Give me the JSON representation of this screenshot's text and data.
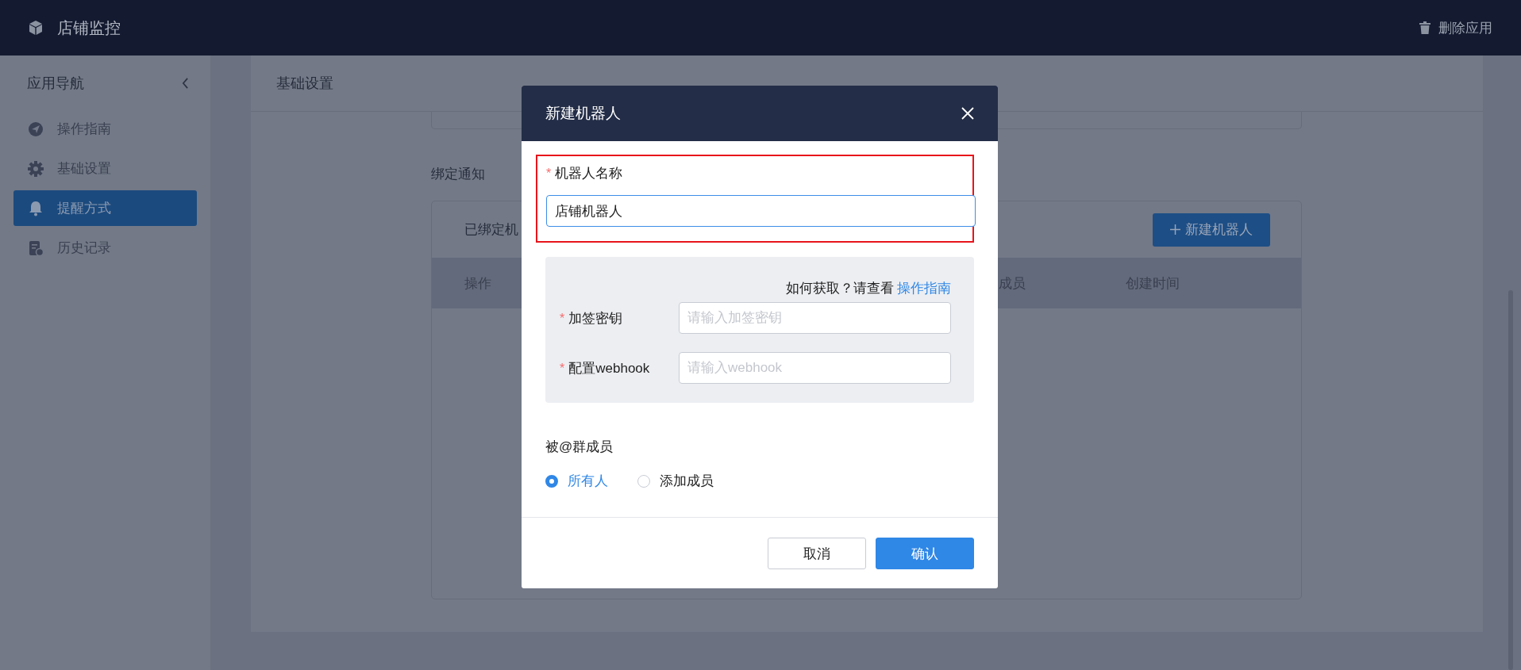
{
  "header": {
    "title": "店铺监控",
    "delete_action": "删除应用"
  },
  "sidebar": {
    "title": "应用导航",
    "items": [
      {
        "label": "操作指南",
        "selected": false
      },
      {
        "label": "基础设置",
        "selected": false
      },
      {
        "label": "提醒方式",
        "selected": true
      },
      {
        "label": "历史记录",
        "selected": false
      }
    ]
  },
  "main": {
    "title": "基础设置",
    "section_title": "绑定通知",
    "table_panel": {
      "heading": "已绑定机",
      "add_button": "新建机器人",
      "columns": [
        "操作",
        "成员",
        "创建时间"
      ]
    }
  },
  "dialog": {
    "title": "新建机器人",
    "name_field": {
      "label": "机器人名称",
      "required_mark": "*",
      "value": "店铺机器人",
      "highlighted": true
    },
    "hint": {
      "text": "如何获取？请查看",
      "link": "操作指南"
    },
    "fields": [
      {
        "label": "加签密钥",
        "required_mark": "*",
        "placeholder": "请输入加签密钥"
      },
      {
        "label": "配置webhook",
        "required_mark": "*",
        "placeholder": "请输入webhook"
      }
    ],
    "mention": {
      "label": "被@群成员",
      "options": [
        {
          "label": "所有人",
          "selected": true
        },
        {
          "label": "添加成员",
          "selected": false
        }
      ]
    },
    "buttons": [
      {
        "label": "取消",
        "kind": "secondary"
      },
      {
        "label": "确认",
        "kind": "primary"
      }
    ]
  }
}
